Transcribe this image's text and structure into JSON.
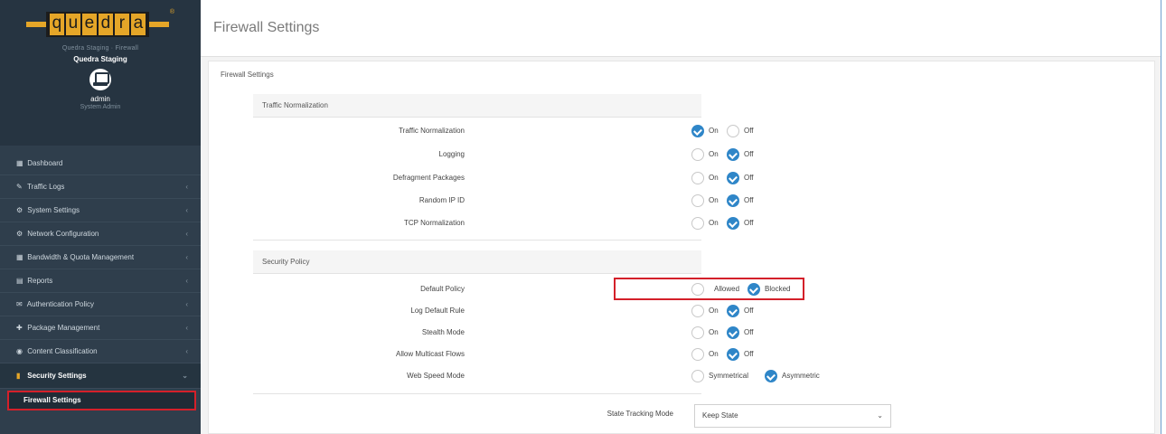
{
  "brand": {
    "logo_letters": [
      "q",
      "u",
      "e",
      "d",
      "r",
      "a"
    ],
    "logo_tm": "®",
    "tagline": "Quedra Staging · Firewall",
    "device_name": "Quedra Staging",
    "user": "admin",
    "role": "System Admin"
  },
  "sidebar": {
    "items": [
      {
        "icon": "▦",
        "label": "Dashboard",
        "chevron": ""
      },
      {
        "icon": "✎",
        "label": "Traffic Logs",
        "chevron": "‹"
      },
      {
        "icon": "⚙",
        "label": "System Settings",
        "chevron": "‹"
      },
      {
        "icon": "⚙",
        "label": "Network Configuration",
        "chevron": "‹"
      },
      {
        "icon": "▦",
        "label": "Bandwidth & Quota Management",
        "chevron": "‹"
      },
      {
        "icon": "▤",
        "label": "Reports",
        "chevron": "‹"
      },
      {
        "icon": "✉",
        "label": "Authentication Policy",
        "chevron": "‹"
      },
      {
        "icon": "✚",
        "label": "Package Management",
        "chevron": "‹"
      },
      {
        "icon": "◉",
        "label": "Content Classification",
        "chevron": "‹"
      },
      {
        "icon": "▮",
        "label": "Security Settings",
        "chevron": "⌄"
      }
    ],
    "sub_item": "Firewall Settings"
  },
  "header": {
    "title": "Firewall Settings"
  },
  "panel": {
    "title": "Firewall Settings"
  },
  "traffic": {
    "heading": "Traffic Normalization",
    "rows": [
      {
        "label": "Traffic Normalization",
        "opt1": "On",
        "opt2": "Off",
        "selected": 1
      },
      {
        "label": "Logging",
        "opt1": "On",
        "opt2": "Off",
        "selected": 2
      },
      {
        "label": "Defragment Packages",
        "opt1": "On",
        "opt2": "Off",
        "selected": 2
      },
      {
        "label": "Random IP ID",
        "opt1": "On",
        "opt2": "Off",
        "selected": 2
      },
      {
        "label": "TCP Normalization",
        "opt1": "On",
        "opt2": "Off",
        "selected": 2
      }
    ]
  },
  "security": {
    "heading": "Security Policy",
    "rows": [
      {
        "label": "Default Policy",
        "opt1": "Allowed",
        "opt2": "Blocked",
        "selected": 2
      },
      {
        "label": "Log Default Rule",
        "opt1": "On",
        "opt2": "Off",
        "selected": 2
      },
      {
        "label": "Stealth Mode",
        "opt1": "On",
        "opt2": "Off",
        "selected": 2
      },
      {
        "label": "Allow Multicast Flows",
        "opt1": "On",
        "opt2": "Off",
        "selected": 2
      },
      {
        "label": "Web Speed Mode",
        "opt1": "Symmetrical",
        "opt2": "Asymmetric",
        "selected": 2
      }
    ]
  },
  "state_tracking": {
    "label": "State Tracking Mode",
    "value": "Keep State",
    "arrow": "⌄"
  }
}
